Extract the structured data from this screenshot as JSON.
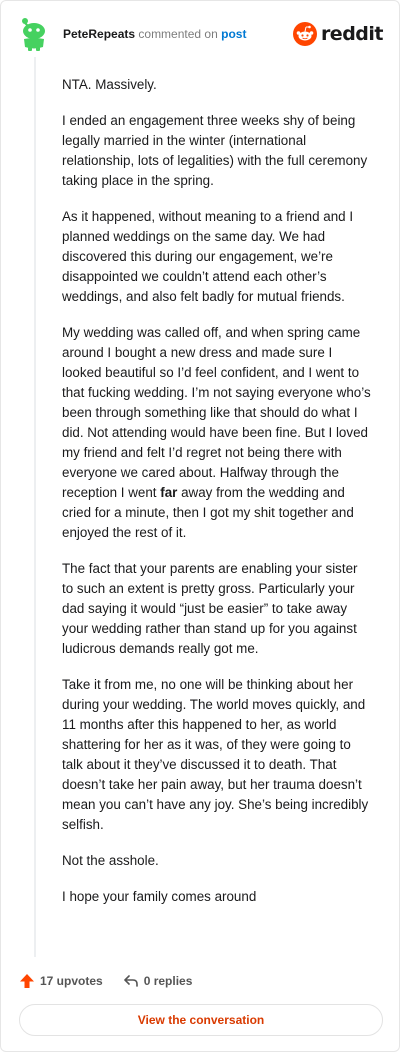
{
  "header": {
    "username": "PeteRepeats",
    "action": "commented on",
    "post_link": "post",
    "brand": "reddit"
  },
  "comment": {
    "paragraphs": [
      "NTA. Massively.",
      "I ended an engagement three weeks shy of being legally married in the winter (international relationship, lots of legalities) with the full ceremony taking place in the spring.",
      "As it happened, without meaning to a friend and I planned weddings on the same day. We had discovered this during our engagement, we’re disappointed we couldn’t attend each other’s weddings, and also felt badly for mutual friends.",
      {
        "before": "My wedding was called off, and when spring came around I bought a new dress and made sure I looked beautiful so I’d feel confident, and I went to that fucking wedding. I’m not saying everyone who’s been through something like that should do what I did. Not attending would have been fine. But I loved my friend and felt I’d regret not being there with everyone we cared about. Halfway through the reception I went ",
        "bold": "far",
        "after": " away from the wedding and cried for a minute, then I got my shit together and enjoyed the rest of it."
      },
      "The fact that your parents are enabling your sister to such an extent is pretty gross. Particularly your dad saying it would “just be easier” to take away your wedding rather than stand up for you against ludicrous demands really got me.",
      "Take it from me, no one will be thinking about her during your wedding. The world moves quickly, and 11 months after this happened to her, as world shattering for her as it was, of they were going to talk about it they’ve discussed it to death. That doesn’t take her pain away, but her trauma doesn’t mean you can’t have any joy. She’s being incredibly selfish.",
      "Not the asshole.",
      "I hope your family comes around"
    ]
  },
  "footer": {
    "upvotes": "17 upvotes",
    "replies": "0 replies"
  },
  "cta": {
    "label": "View the conversation"
  },
  "colors": {
    "reddit_orange": "#ff4500",
    "link_blue": "#0079d3",
    "cta_text": "#d93a00",
    "avatar_green": "#46d160"
  },
  "icons": {
    "avatar": "snoo-avatar-icon",
    "brand": "reddit-logo-icon",
    "upvote": "upvote-arrow-icon",
    "reply": "reply-arrow-icon"
  }
}
